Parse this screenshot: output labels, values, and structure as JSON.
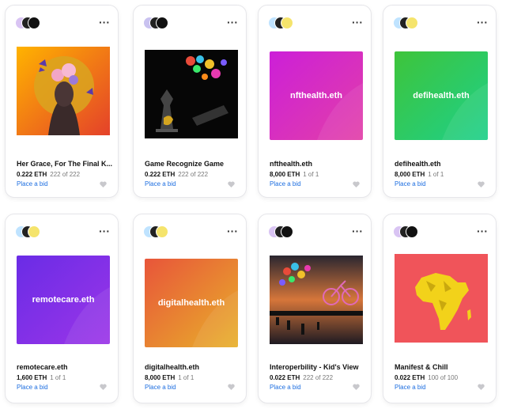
{
  "cards": [
    {
      "title": "Her Grace, For The Final K...",
      "price": "0.222 ETH",
      "edition": "222 of 222",
      "bid": "Place a bid",
      "art_label": ""
    },
    {
      "title": "Game Recognize Game",
      "price": "0.222 ETH",
      "edition": "222 of 222",
      "bid": "Place a bid",
      "art_label": ""
    },
    {
      "title": "nfthealth.eth",
      "price": "8,000 ETH",
      "edition": "1 of 1",
      "bid": "Place a bid",
      "art_label": "nfthealth.eth"
    },
    {
      "title": "defihealth.eth",
      "price": "8,000 ETH",
      "edition": "1 of 1",
      "bid": "Place a bid",
      "art_label": "defihealth.eth"
    },
    {
      "title": "remotecare.eth",
      "price": "1,600 ETH",
      "edition": "1 of 1",
      "bid": "Place a bid",
      "art_label": "remotecare.eth"
    },
    {
      "title": "digitalhealth.eth",
      "price": "8,000 ETH",
      "edition": "1 of 1",
      "bid": "Place a bid",
      "art_label": "digitalhealth.eth"
    },
    {
      "title": "Interoperbility - Kid's View",
      "price": "0.022 ETH",
      "edition": "222 of 222",
      "bid": "Place a bid",
      "art_label": ""
    },
    {
      "title": "Manifest & Chill",
      "price": "0.022 ETH",
      "edition": "100 of 100",
      "bid": "Place a bid",
      "art_label": ""
    }
  ],
  "more_icon": "···",
  "colors": {
    "link": "#1d6ee0",
    "heart": "#c8c8cc"
  }
}
